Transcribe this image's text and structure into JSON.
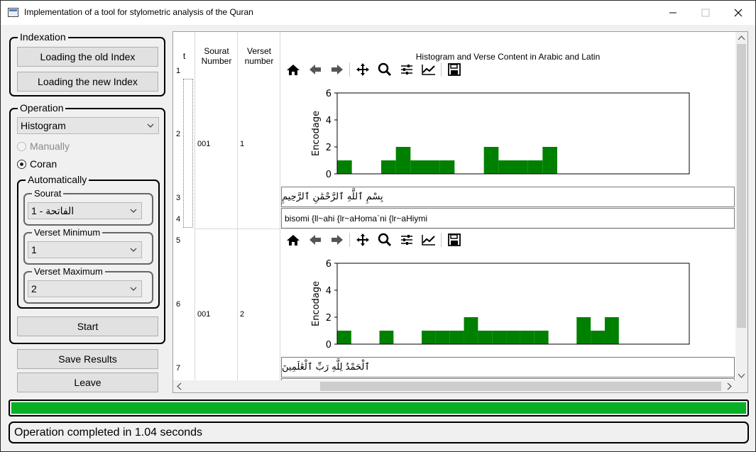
{
  "window": {
    "title": "Implementation of a tool for stylometric analysis of the Quran"
  },
  "indexation": {
    "title": "Indexation",
    "load_old_label": "Loading the old Index",
    "load_new_label": "Loading the new Index"
  },
  "operation": {
    "title": "Operation",
    "selected": "Histogram",
    "manually_label": "Manually",
    "coran_label": "Coran",
    "automatically": {
      "title": "Automatically",
      "sourat_title": "Sourat",
      "sourat_value": "1 - الفاتحة",
      "verset_min_title": "Verset Minimum",
      "verset_min_value": "1",
      "verset_max_title": "Verset Maximum",
      "verset_max_value": "2"
    },
    "start_label": "Start"
  },
  "actions": {
    "save_label": "Save Results",
    "leave_label": "Leave"
  },
  "table": {
    "headers": {
      "t": "t",
      "sourat": "Sourat Number",
      "verset": "Verset number",
      "content": "Histogram and Verse Content in Arabic and Latin"
    },
    "row_numbers": [
      "1",
      "2",
      "3",
      "4",
      "5",
      "6",
      "7"
    ],
    "rows": [
      {
        "sourat": "001",
        "verset": "1",
        "arabic": "بِسْمِ ٱللَّهِ ٱلرَّحْمَٰنِ ٱلرَّحِيمِ",
        "latin": "bisomi {ll~ahi {lr~aHoma`ni {lr~aHiymi"
      },
      {
        "sourat": "001",
        "verset": "2",
        "arabic": "ٱلْحَمْدُ لِلَّهِ رَبِّ ٱلْعَٰلَمِينَ",
        "latin": ""
      }
    ]
  },
  "chart_data": [
    {
      "type": "bar",
      "title": "",
      "xlabel": "",
      "ylabel": "Encodage",
      "ylim": [
        0,
        6
      ],
      "yticks": [
        "0",
        "2",
        "4",
        "6"
      ],
      "color": "#008000",
      "values": [
        1,
        0,
        0,
        1,
        2,
        1,
        1,
        1,
        0,
        0,
        2,
        1,
        1,
        1,
        2,
        0,
        0,
        0,
        0,
        0,
        0,
        0,
        0,
        0
      ]
    },
    {
      "type": "bar",
      "title": "",
      "xlabel": "",
      "ylabel": "Encodage",
      "ylim": [
        0,
        6
      ],
      "yticks": [
        "0",
        "2",
        "4",
        "6"
      ],
      "color": "#008000",
      "values": [
        1,
        0,
        0,
        1,
        0,
        0,
        1,
        1,
        1,
        2,
        1,
        1,
        1,
        1,
        1,
        0,
        0,
        2,
        1,
        2,
        0,
        0,
        0,
        0,
        0
      ]
    }
  ],
  "progress": {
    "value": 100,
    "color": "#06b025"
  },
  "status": {
    "text": "Operation completed in 1.04 seconds"
  }
}
